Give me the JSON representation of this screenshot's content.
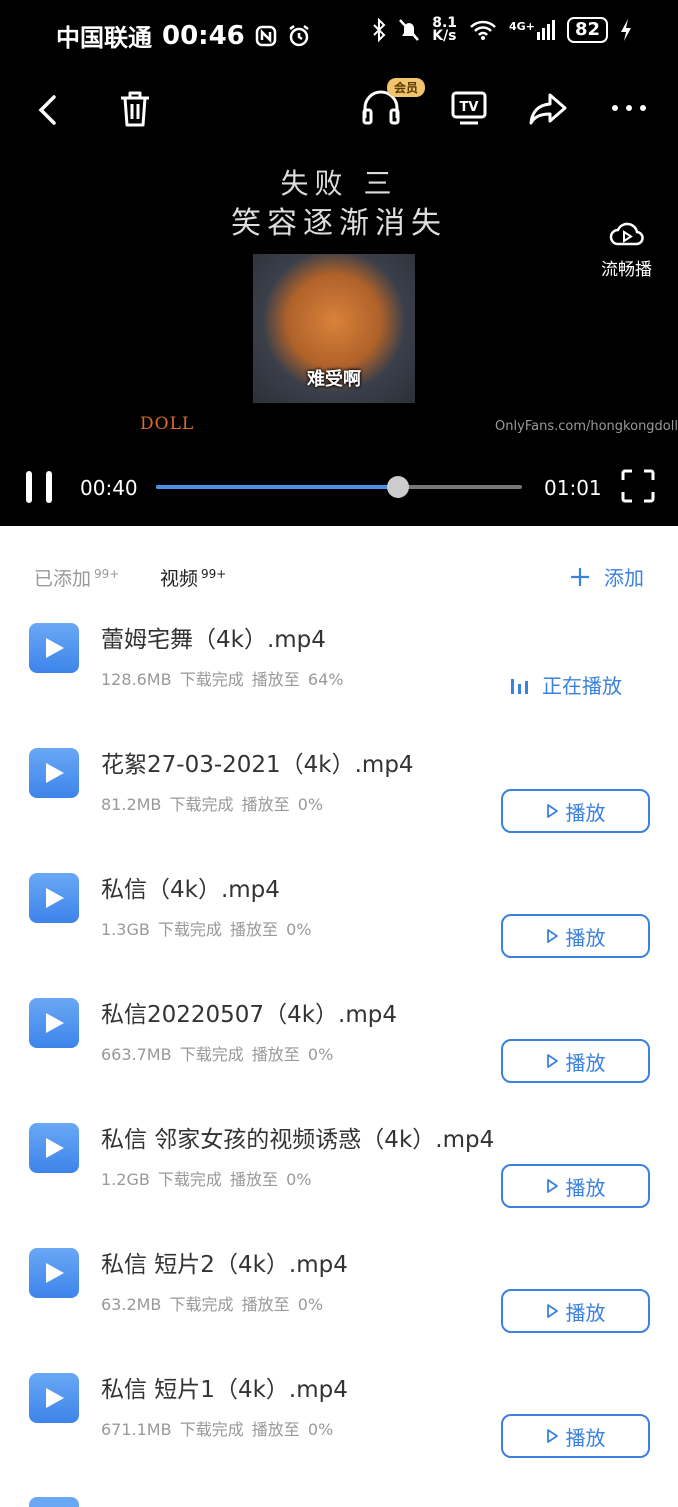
{
  "status_bar": {
    "carrier": "中国联通",
    "time": "00:46",
    "net_speed_top": "8.1",
    "net_speed_unit": "K/s",
    "network": "4G+",
    "battery": "82"
  },
  "top_bar": {
    "vip_badge": "会员"
  },
  "video": {
    "title_line1": "失败 三",
    "title_line2": "笑容逐渐消失",
    "caption": "难受啊",
    "brand": "DOLL",
    "watermark": "OnlyFans.com/hongkongdoll",
    "smooth_label": "流畅播"
  },
  "controls": {
    "current_time": "00:40",
    "total_time": "01:01",
    "progress": 0.66
  },
  "tabs": {
    "added_label": "已添加",
    "added_count": "99+",
    "video_label": "视频",
    "video_count": "99+",
    "add_label": "添加"
  },
  "files": [
    {
      "name": "蕾姆宅舞（4k）.mp4",
      "size": "128.6MB",
      "status": "下载完成",
      "progress": "播放至 64%",
      "state": "正在播放"
    },
    {
      "name": "花絮27-03-2021（4k）.mp4",
      "size": "81.2MB",
      "status": "下载完成",
      "progress": "播放至 0%",
      "state": "播放"
    },
    {
      "name": "私信（4k）.mp4",
      "size": "1.3GB",
      "status": "下载完成",
      "progress": "播放至 0%",
      "state": "播放"
    },
    {
      "name": "私信20220507（4k）.mp4",
      "size": "663.7MB",
      "status": "下载完成",
      "progress": "播放至 0%",
      "state": "播放"
    },
    {
      "name": "私信 邻家女孩的视频诱惑（4k）.mp4",
      "size": "1.2GB",
      "status": "下载完成",
      "progress": "播放至 0%",
      "state": "播放"
    },
    {
      "name": "私信 短片2（4k）.mp4",
      "size": "63.2MB",
      "status": "下载完成",
      "progress": "播放至 0%",
      "state": "播放"
    },
    {
      "name": "私信 短片1（4k）.mp4",
      "size": "671.1MB",
      "status": "下载完成",
      "progress": "播放至 0%",
      "state": "播放"
    }
  ],
  "colors": {
    "accent": "#3b82e0",
    "player_bg": "#000000",
    "file_icon": "#4a8ff0"
  }
}
